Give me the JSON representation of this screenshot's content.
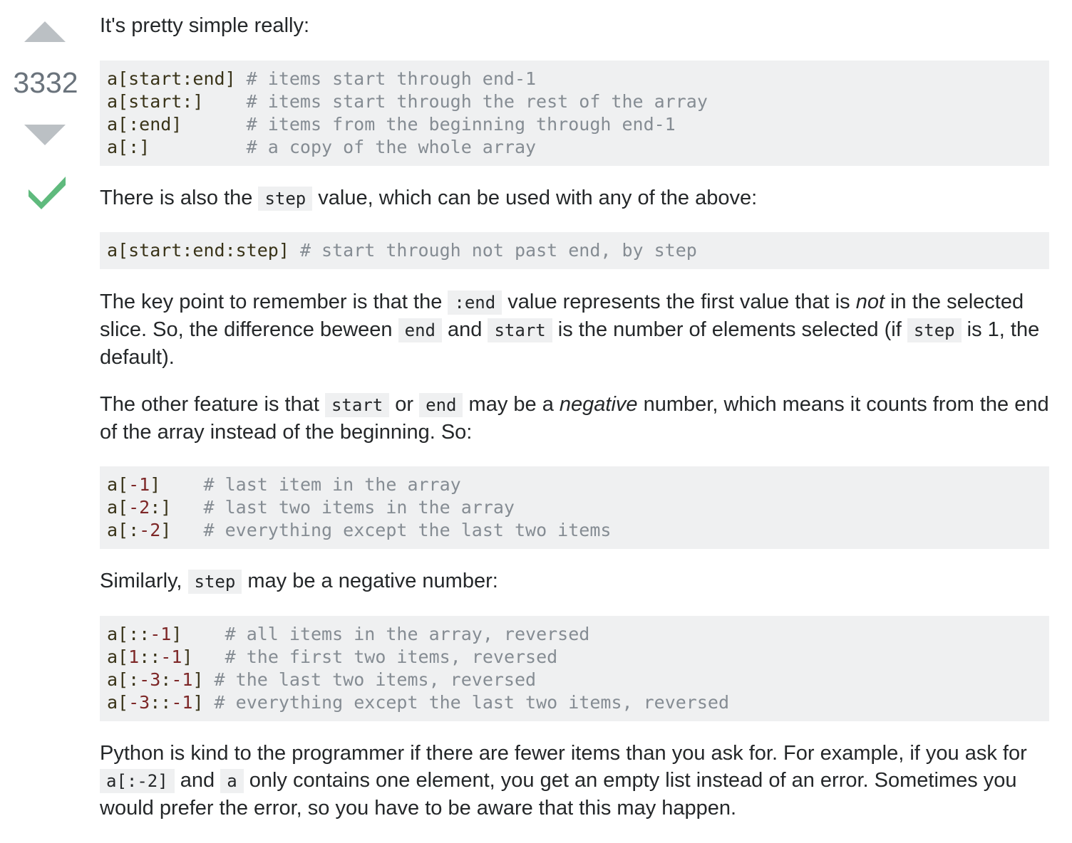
{
  "vote": {
    "count": "3332"
  },
  "paragraphs": {
    "p1": "It's pretty simple really:",
    "p2_a": "There is also the ",
    "p2_code": "step",
    "p2_b": " value, which can be used with any of the above:",
    "p3_a": "The key point to remember is that the ",
    "p3_code1": ":end",
    "p3_b": " value represents the first value that is ",
    "p3_em": "not",
    "p3_c": " in the selected slice. So, the difference beween ",
    "p3_code2": "end",
    "p3_d": " and ",
    "p3_code3": "start",
    "p3_e": " is the number of elements selected (if ",
    "p3_code4": "step",
    "p3_f": " is 1, the default).",
    "p4_a": "The other feature is that ",
    "p4_code1": "start",
    "p4_b": " or ",
    "p4_code2": "end",
    "p4_c": " may be a ",
    "p4_em": "negative",
    "p4_d": " number, which means it counts from the end of the array instead of the beginning. So:",
    "p5_a": "Similarly, ",
    "p5_code": "step",
    "p5_b": " may be a negative number:",
    "p6_a": "Python is kind to the programmer if there are fewer items than you ask for. For example, if you ask for ",
    "p6_code1": "a[:-2]",
    "p6_b": " and ",
    "p6_code2": "a",
    "p6_c": " only contains one element, you get an empty list instead of an error. Sometimes you would prefer the error, so you have to be aware that this may happen."
  },
  "code_blocks": {
    "block1": [
      {
        "code": "a[start:end] ",
        "comment": "# items start through end-1"
      },
      {
        "code": "a[start:]    ",
        "comment": "# items start through the rest of the array"
      },
      {
        "code": "a[:end]      ",
        "comment": "# items from the beginning through end-1"
      },
      {
        "code": "a[:]         ",
        "comment": "# a copy of the whole array"
      }
    ],
    "block2": [
      {
        "code": "a[start:end:step] ",
        "comment": "# start through not past end, by step"
      }
    ],
    "block3": [
      {
        "pre": "a[",
        "num": "-1",
        "post": "]    ",
        "comment": "# last item in the array"
      },
      {
        "pre": "a[",
        "num": "-2",
        "post": ":]   ",
        "comment": "# last two items in the array"
      },
      {
        "pre": "a[:",
        "num": "-2",
        "post": "]   ",
        "comment": "# everything except the last two items"
      }
    ],
    "block4": [
      {
        "parts": [
          [
            "t",
            "a[::"
          ],
          [
            "n",
            "-1"
          ],
          [
            "t",
            "]    "
          ]
        ],
        "comment": "# all items in the array, reversed"
      },
      {
        "parts": [
          [
            "t",
            "a["
          ],
          [
            "n",
            "1"
          ],
          [
            "t",
            "::"
          ],
          [
            "n",
            "-1"
          ],
          [
            "t",
            "]   "
          ]
        ],
        "comment": "# the first two items, reversed"
      },
      {
        "parts": [
          [
            "t",
            "a[:"
          ],
          [
            "n",
            "-3"
          ],
          [
            "t",
            ":"
          ],
          [
            "n",
            "-1"
          ],
          [
            "t",
            "] "
          ]
        ],
        "comment": "# the last two items, reversed"
      },
      {
        "parts": [
          [
            "t",
            "a["
          ],
          [
            "n",
            "-3"
          ],
          [
            "t",
            "::"
          ],
          [
            "n",
            "-1"
          ],
          [
            "t",
            "] "
          ]
        ],
        "comment": "# everything except the last two items, reversed"
      }
    ]
  },
  "colors": {
    "accepted": "#5fba7d",
    "vote_arrow": "#bbc0c4",
    "code_bg": "#eff0f1",
    "number": "#7d2727",
    "comment": "#858c93"
  }
}
